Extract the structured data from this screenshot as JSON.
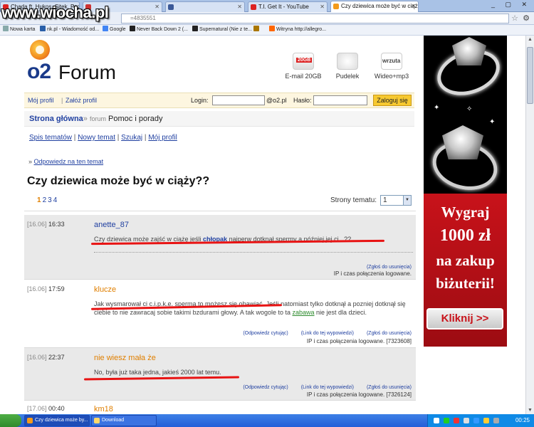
{
  "browser": {
    "tabs": [
      {
        "label": "Chada ft. Hukos, Sitek, Pezet",
        "color": "#d22"
      },
      {
        "label": "",
        "color": "#c33"
      },
      {
        "label": "",
        "color": "#3b5998"
      },
      {
        "label": "T.I. Get It - YouTube",
        "color": "#d22"
      },
      {
        "label": "Czy dziewica może być w ciąży",
        "color": "#f39a1b"
      }
    ],
    "watermark": "www.wiocha.pl",
    "url_fragment": "=4835551",
    "bookmarks": [
      {
        "label": "Nowa karta",
        "color": "#8aa"
      },
      {
        "label": "nk.pl - Wiadomość od...",
        "color": "#2a5fa8"
      },
      {
        "label": "Google",
        "color": "#4285f4"
      },
      {
        "label": "Never Back Down 2 (...",
        "color": "#222"
      },
      {
        "label": "Supernatural (Nie z te...",
        "color": "#222"
      },
      {
        "label": "",
        "color": "#a70"
      },
      {
        "label": "Witryna http://allegro...",
        "color": "#f60"
      }
    ]
  },
  "header": {
    "logo_o2": "o2",
    "logo_forum": "Forum",
    "services": [
      {
        "label": "E-mail 20GB",
        "badge": "20GB"
      },
      {
        "label": "Pudelek",
        "badge": ""
      },
      {
        "label": "Wideo+mp3",
        "badge": "wrzuta"
      }
    ]
  },
  "loginbar": {
    "my_profile": "Mój profil",
    "create_profile": "Załóż profil",
    "login_label": "Login:",
    "domain": "@o2.pl",
    "password_label": "Hasło:",
    "login_button": "Zaloguj się"
  },
  "breadcrumb": {
    "home": "Strona główna",
    "sep": "»",
    "forum": "forum",
    "section": "Pomoc i porady"
  },
  "subnav": [
    "Spis tematów",
    "Nowy temat",
    "Szukaj",
    "Mój profil"
  ],
  "reply_link": "Odpowiedz na ten temat",
  "reply_prefix": "»",
  "topic_title": "Czy dziewica może być w ciąży??",
  "pagination": {
    "current": "1",
    "pages": [
      "2",
      "3",
      "4"
    ],
    "select_label": "Strony tematu:",
    "select_value": "1"
  },
  "posts": [
    {
      "date": "[16.06]",
      "time": "16:33",
      "author": "anette_87",
      "author_color": "#1f3fa0",
      "msg_pre": "Czy dziewica może zajść w ciążę jeśli ",
      "msg_link": "chłopak",
      "msg_post": " najperw dotknął spermy a później jej ci...??",
      "report": "(Zgłoś do usunięcia)",
      "ip": "IP i czas połączenia logowane."
    },
    {
      "date": "[16.06]",
      "time": "17:59",
      "author": "klucze",
      "author_color": "#e07f00",
      "msg_pre": "Jak wysmarował ci c.i.p.k.e. sperma to możesz się obawiać. Jeśli natomiast tylko dotknął a pozniej dotknął się ciebie to nie zawracaj sobie takimi bzdurami głowy. A tak wogole to ta ",
      "msg_link": "zabawa",
      "msg_post": " nie jest dla dzieci.",
      "reply": "(Odpowiedz cytując)",
      "link": "(Link do tej wypowiedzi)",
      "report": "(Zgłoś do usunięcia)",
      "ip": "IP i czas połączenia logowane. [7323608]"
    },
    {
      "date": "[16.06]",
      "time": "22:37",
      "author": "nie wiesz mała że",
      "author_color": "#e07f00",
      "msg_pre": "No, była już taka jedna, jakieś 2000 lat temu.",
      "reply": "(Odpowiedz cytując)",
      "link": "(Link do tej wypowiedzi)",
      "report": "(Zgłoś do usunięcia)",
      "ip": "IP i czas połączenia logowane. [7326124]"
    },
    {
      "date": "[17.06]",
      "time": "00:40",
      "author": "km18",
      "author_color": "#e07f00"
    }
  ],
  "ad": {
    "line1": "Wygraj",
    "line2": "1000 zł",
    "line3": "na zakup",
    "line4": "biżuterii!",
    "cta": "Kliknij >>",
    "accent": "#c8121a"
  },
  "taskbar": {
    "tasks": [
      {
        "label": "Czy dziewica może by...",
        "active": true
      },
      {
        "label": "Download",
        "active": false
      }
    ],
    "clock": "00:25"
  }
}
